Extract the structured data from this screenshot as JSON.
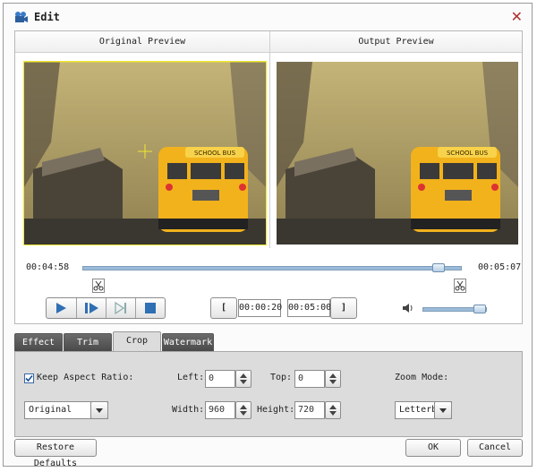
{
  "window": {
    "title": "Edit"
  },
  "preview": {
    "original_label": "Original Preview",
    "output_label": "Output Preview",
    "bus_sign": "SCHOOL BUS"
  },
  "timeline": {
    "current_time": "00:04:58",
    "end_time": "00:05:07",
    "progress": 0.94
  },
  "trim_controls": {
    "start_time": "00:00:20",
    "end_time": "00:05:00",
    "start_bracket": "[",
    "end_bracket": "]"
  },
  "volume": {
    "level": 0.9
  },
  "tabs": [
    {
      "label": "Effect"
    },
    {
      "label": "Trim"
    },
    {
      "label": "Crop"
    },
    {
      "label": "Watermark"
    }
  ],
  "active_tab": "Crop",
  "crop": {
    "keep_aspect_label": "Keep Aspect Ratio:",
    "keep_aspect_checked": true,
    "left_label": "Left:",
    "left_value": "0",
    "top_label": "Top:",
    "top_value": "0",
    "zoom_mode_label": "Zoom Mode:",
    "aspect_select": "Original",
    "width_label": "Width:",
    "width_value": "960",
    "height_label": "Height:",
    "height_value": "720",
    "zoom_select": "Letterbox"
  },
  "footer": {
    "restore_label": "Restore Defaults",
    "ok_label": "OK",
    "cancel_label": "Cancel"
  },
  "colors": {
    "crop_frame": "#f0e830",
    "accent_blue": "#2f6fb4",
    "sky_sepia": "#a89858",
    "bus_yellow": "#f2b21c"
  },
  "icons": [
    "app-icon",
    "close-icon",
    "scissor-icon",
    "play-icon",
    "step-forward-icon",
    "next-frame-icon",
    "stop-icon",
    "volume-icon",
    "chevron-down-icon",
    "spin-arrows-icon",
    "check-icon"
  ]
}
